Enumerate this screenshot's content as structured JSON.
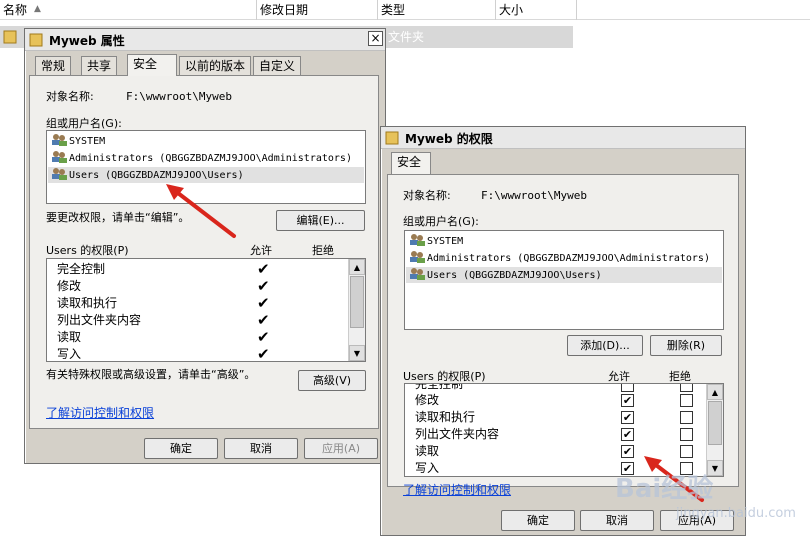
{
  "explorer": {
    "columns": [
      "名称",
      "修改日期",
      "类型",
      "大小"
    ],
    "row_type_text": "文件夹"
  },
  "props_dialog": {
    "title": "Myweb 属性",
    "close": "×",
    "tabs": [
      "常规",
      "共享",
      "安全",
      "以前的版本",
      "自定义"
    ],
    "object_name_label": "对象名称:",
    "object_name_value": "F:\\wwwroot\\Myweb",
    "group_label": "组或用户名(G):",
    "users": [
      "SYSTEM",
      "Administrators (QBGGZBDAZMJ9JOO\\Administrators)",
      "Users (QBGGZBDAZMJ9JOO\\Users)"
    ],
    "change_hint": "要更改权限，请单击“编辑”。",
    "edit_button": "编辑(E)...",
    "perm_header": "Users 的权限(P)",
    "allow_label": "允许",
    "deny_label": "拒绝",
    "permissions": [
      "完全控制",
      "修改",
      "读取和执行",
      "列出文件夹内容",
      "读取",
      "写入"
    ],
    "allow_checked": [
      true,
      true,
      true,
      true,
      true,
      true
    ],
    "special_hint": "有关特殊权限或高级设置，请单击“高级”。",
    "advanced_button": "高级(V)",
    "learn_link": "了解访问控制和权限",
    "ok": "确定",
    "cancel": "取消",
    "apply": "应用(A)"
  },
  "perm_dialog": {
    "title": "Myweb 的权限",
    "tab": "安全",
    "object_name_label": "对象名称:",
    "object_name_value": "F:\\wwwroot\\Myweb",
    "group_label": "组或用户名(G):",
    "users": [
      "SYSTEM",
      "Administrators (QBGGZBDAZMJ9JOO\\Administrators)",
      "Users (QBGGZBDAZMJ9JOO\\Users)"
    ],
    "add_button": "添加(D)...",
    "remove_button": "删除(R)",
    "perm_header": "Users 的权限(P)",
    "allow_label": "允许",
    "deny_label": "拒绝",
    "permissions": [
      "完全控制",
      "修改",
      "读取和执行",
      "列出文件夹内容",
      "读取",
      "写入"
    ],
    "allow_checked": [
      false,
      true,
      true,
      true,
      true,
      true
    ],
    "deny_checked": [
      false,
      false,
      false,
      false,
      false,
      false
    ],
    "check_mark": "✔",
    "learn_link": "了解访问控制和权限",
    "ok": "确定",
    "cancel": "取消",
    "apply": "应用(A)"
  },
  "watermark": {
    "text": "Bai经验",
    "sub": "jingyan.baidu.com"
  },
  "colors": {
    "link": "#0a41d8",
    "arrow": "#d9261c",
    "dialog_bg": "#d4d0c8"
  }
}
